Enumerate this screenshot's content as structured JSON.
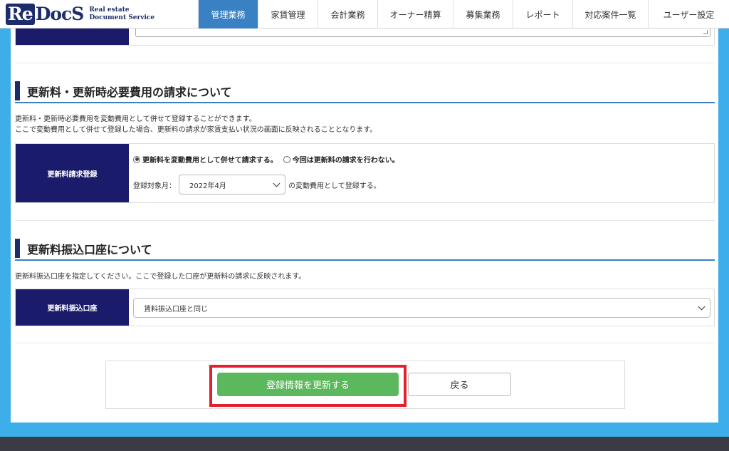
{
  "header": {
    "logo_mark_re": "Re",
    "logo_mark_docs": "DocS",
    "logo_tag_line1": "Real estate",
    "logo_tag_line2": "Document Service",
    "nav": [
      {
        "label": "管理業務",
        "active": true
      },
      {
        "label": "家賃管理",
        "active": false
      },
      {
        "label": "会計業務",
        "active": false
      },
      {
        "label": "オーナー精算",
        "active": false
      },
      {
        "label": "募集業務",
        "active": false
      },
      {
        "label": "レポート",
        "active": false
      },
      {
        "label": "対応案件一覧",
        "active": false
      },
      {
        "label": "ユーザー設定",
        "active": false
      }
    ]
  },
  "section_renewal_fee": {
    "title": "更新料・更新時必要費用の請求について",
    "desc_line1": "更新料・更新時必要費用を変動費用として併せて登録することができます。",
    "desc_line2": "ここで変動費用として併せて登録した場合、更新料の請求が家賃支払い状況の画面に反映されることとなります。",
    "row_label": "更新料請求登録",
    "option_combine": "更新料を変動費用として併せて請求する。",
    "option_none": "今回は更新料の請求を行わない。",
    "selected_option": "option_combine",
    "month_label": "登録対象月：",
    "month_value": "2022年4月",
    "month_suffix": "の変動費用として登録する。"
  },
  "section_account": {
    "title": "更新料振込口座について",
    "desc": "更新料振込口座を指定してください。ここで登録した口座が更新料の請求に反映されます。",
    "row_label": "更新料振込口座",
    "account_value": "賃料振込口座と同じ"
  },
  "actions": {
    "update_label": "登録情報を更新する",
    "back_label": "戻る"
  },
  "colors": {
    "nav_active": "#3a81c4",
    "label_bg": "#1b1b6b",
    "primary_button": "#5cb85c",
    "highlight": "#e3202d",
    "page_bg": "#3daee9"
  }
}
